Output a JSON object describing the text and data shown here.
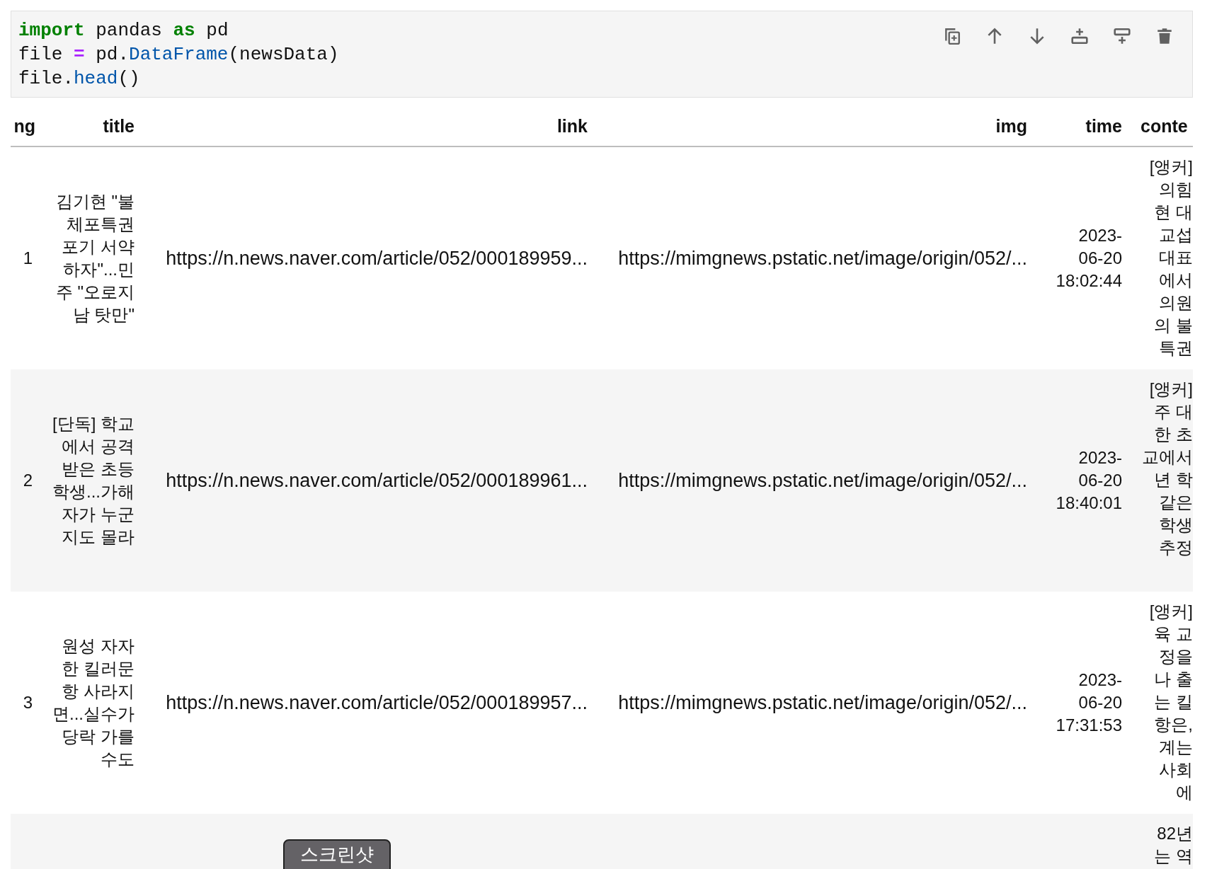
{
  "code_cell": {
    "lines": [
      [
        {
          "text": "import",
          "kind": "keyword"
        },
        {
          "text": " pandas ",
          "kind": "plain"
        },
        {
          "text": "as",
          "kind": "keyword"
        },
        {
          "text": " pd",
          "kind": "plain"
        }
      ],
      [
        {
          "text": "file ",
          "kind": "plain"
        },
        {
          "text": "=",
          "kind": "operator"
        },
        {
          "text": " pd.",
          "kind": "plain"
        },
        {
          "text": "DataFrame",
          "kind": "attribute"
        },
        {
          "text": "(newsData)",
          "kind": "plain"
        }
      ],
      [
        {
          "text": "file.",
          "kind": "plain"
        },
        {
          "text": "head",
          "kind": "attribute"
        },
        {
          "text": "()",
          "kind": "plain"
        }
      ]
    ],
    "toolbar": [
      {
        "kind": "duplicate"
      },
      {
        "kind": "move-up"
      },
      {
        "kind": "move-down"
      },
      {
        "kind": "insert-above"
      },
      {
        "kind": "insert-below"
      },
      {
        "kind": "delete"
      }
    ]
  },
  "table": {
    "columns": [
      "ng",
      "title",
      "link",
      "img",
      "time",
      "conte"
    ],
    "rows": [
      {
        "index": "1",
        "title": "김기현 \"불\n체포특권\n포기 서약\n하자\"...민\n주 \"오로지\n남 탓만\"",
        "link": "https://n.news.naver.com/article/052/000189959...",
        "img": "https://mimgnews.pstatic.net/image/origin/052/...",
        "time": "2023-06-20 18:02:44",
        "content": "[앵커]\n의힘\n현 대\n교섭\n대표\n에서\n의원\n의 불\n특권"
      },
      {
        "index": "2",
        "title": "[단독] 학교\n에서 공격\n받은 초등\n학생...가해\n자가 누군\n지도 몰라",
        "link": "https://n.news.naver.com/article/052/000189961...",
        "img": "https://mimgnews.pstatic.net/image/origin/052/...",
        "time": "2023-06-20 18:40:01",
        "content": "[앵커]\n주 대\n한 초\n교에서\n년 학\n같은\n학생\n추정"
      },
      {
        "index": "3",
        "title": "원성 자자\n한 킬러문\n항 사라지\n면...실수가\n당락 가를\n수도",
        "link": "https://n.news.naver.com/article/052/000189957...",
        "img": "https://mimgnews.pstatic.net/image/origin/052/...",
        "time": "2023-06-20 17:31:53",
        "content": "[앵커]\n육 교\n정을\n나 출\n는 킬\n항은,\n계는\n사회\n에"
      },
      {
        "content": "82년\n는 역"
      }
    ]
  },
  "overlay_button": {
    "label": "스크린샷"
  }
}
